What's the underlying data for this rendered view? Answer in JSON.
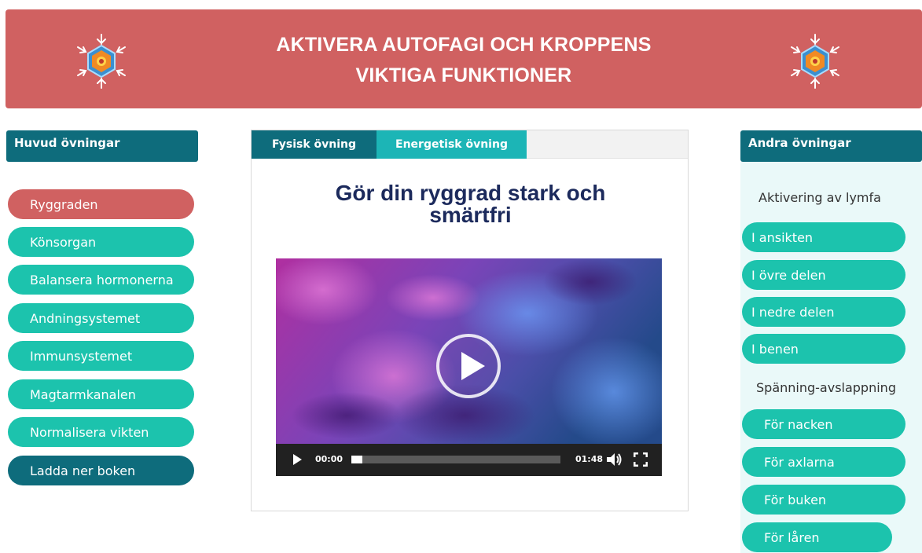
{
  "banner": {
    "title_line1": "AKTIVERA AUTOFAGI OCH KROPPENS",
    "title_line2": "VIKTIGA FUNKTIONER",
    "logo_icon": "snowflake-hexagon-logo-icon"
  },
  "left_sidebar": {
    "header": "Huvud övningar",
    "items": [
      {
        "label": "Ryggraden",
        "state": "active"
      },
      {
        "label": "Könsorgan"
      },
      {
        "label": "Balansera hormonerna"
      },
      {
        "label": "Andningsystemet"
      },
      {
        "label": "Immunsystemet"
      },
      {
        "label": "Magtarmkanalen"
      },
      {
        "label": "Normalisera vikten"
      },
      {
        "label": "Ladda ner boken"
      }
    ]
  },
  "main": {
    "tabs": [
      {
        "label": "Fysisk övning",
        "active": true
      },
      {
        "label": "Energetisk övning"
      }
    ],
    "title_line1": "Gör din ryggrad stark och",
    "title_line2": "smärtfri",
    "video": {
      "current_time": "00:00",
      "duration": "01:48",
      "progress": 0.0
    }
  },
  "right_sidebar": {
    "header": "Andra övningar",
    "section1_label": "Aktivering av lymfa",
    "section1_items": [
      "I ansikten",
      "I övre delen",
      "I nedre delen",
      "I benen"
    ],
    "section2_label": "Spänning-avslappning",
    "section2_items": [
      "För nacken",
      "För axlarna",
      "För buken",
      "För låren"
    ]
  },
  "colors": {
    "banner": "#d06161",
    "teal": "#1cc3ad",
    "dark_teal": "#0e6c7c",
    "tab_teal": "#1cb5b6",
    "title_navy": "#1c2a5c"
  }
}
